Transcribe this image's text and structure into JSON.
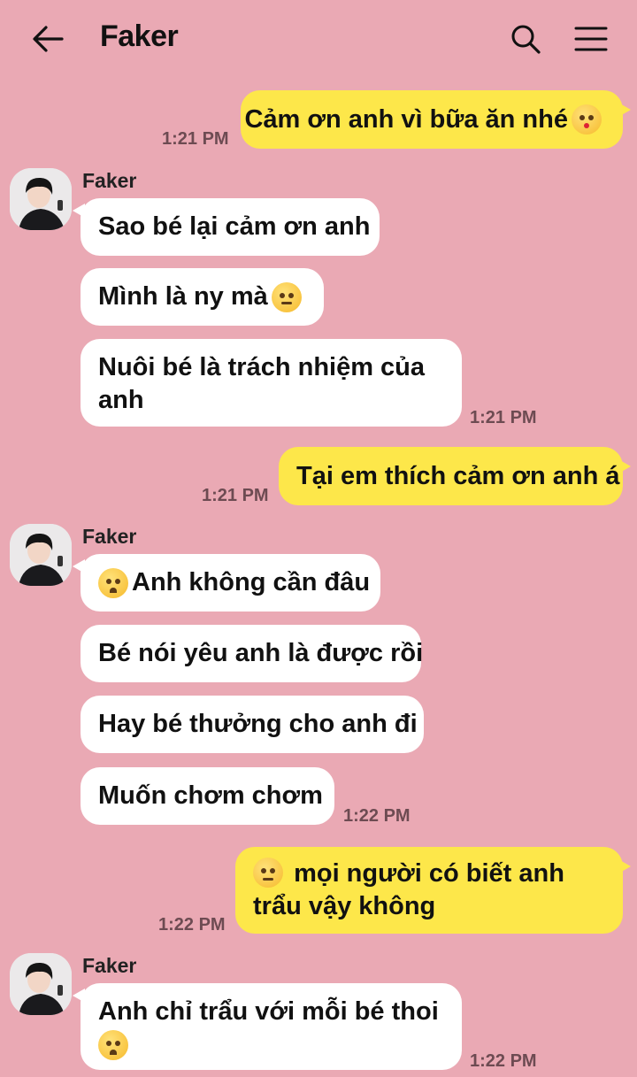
{
  "header": {
    "back_icon": "arrow-left-icon",
    "title": "Faker",
    "search_icon": "search-icon",
    "menu_icon": "hamburger-menu-icon"
  },
  "colors": {
    "background": "#eaa9b4",
    "my_bubble": "#fde74a",
    "their_bubble": "#ffffff"
  },
  "messages": [
    {
      "from": "me",
      "text": "Cảm ơn anh vì bữa ăn nhé",
      "emoji": "kissing-wink-emoji",
      "time": "1:21 PM"
    },
    {
      "from": "them",
      "sender": "Faker",
      "group": [
        {
          "text": "Sao bé lại cảm ơn anh"
        },
        {
          "text": "Mình là ny mà",
          "emoji": "pensive-emoji"
        },
        {
          "text": "Nuôi bé là trách nhiệm của anh",
          "time": "1:21 PM"
        }
      ]
    },
    {
      "from": "me",
      "text": "Tại em thích cảm ơn anh á",
      "time": "1:21 PM"
    },
    {
      "from": "them",
      "sender": "Faker",
      "group": [
        {
          "text": "Anh không cần đâu",
          "emoji": "pleading-emoji"
        },
        {
          "text": "Bé nói yêu anh là được rồi"
        },
        {
          "text": "Hay bé thưởng cho anh đi"
        },
        {
          "text": "Muốn chơm chơm",
          "time": "1:22 PM"
        }
      ]
    },
    {
      "from": "me",
      "text": "mọi người có biết anh trẩu vậy không",
      "emoji": "unamused-emoji",
      "time": "1:22 PM"
    },
    {
      "from": "them",
      "sender": "Faker",
      "group": [
        {
          "text": "Anh chỉ trẩu với mỗi bé thoi",
          "emoji": "pleading-emoji",
          "time": "1:22 PM"
        }
      ]
    }
  ]
}
